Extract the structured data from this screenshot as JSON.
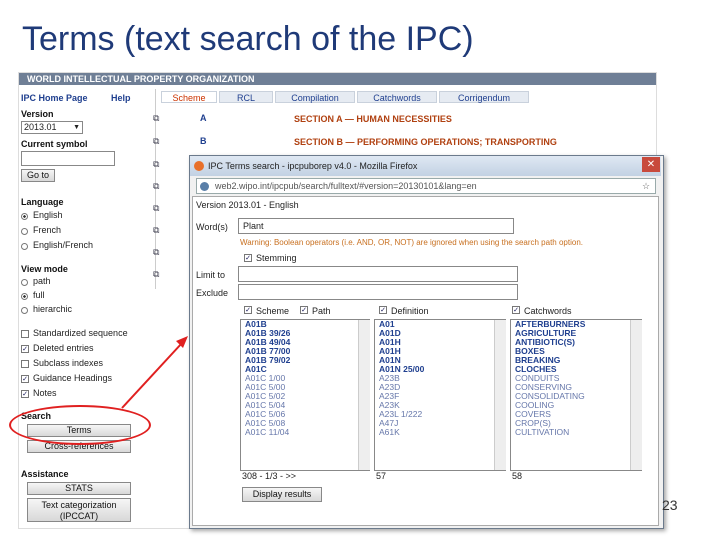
{
  "slide": {
    "title": "Terms (text search of the IPC)",
    "page_number": "23"
  },
  "wipo": {
    "header": "WORLD INTELLECTUAL PROPERTY ORGANIZATION",
    "nav": {
      "home": "IPC Home Page",
      "help": "Help"
    },
    "version_label": "Version",
    "version_value": "2013.01",
    "current_symbol_label": "Current symbol",
    "goto_button": "Go to",
    "language_label": "Language",
    "languages": [
      "English",
      "French",
      "English/French"
    ],
    "view_mode_label": "View mode",
    "view_modes": [
      "path",
      "full",
      "hierarchic"
    ],
    "options": [
      "Standardized sequence",
      "Deleted entries",
      "Subclass indexes",
      "Guidance Headings",
      "Notes"
    ],
    "search_label": "Search",
    "terms_button": "Terms",
    "crossref_button": "Cross-references",
    "assistance_label": "Assistance",
    "stats_button": "STATS",
    "textcat_button": "Text categorization (IPCCAT)",
    "tabs": [
      "Scheme",
      "RCL",
      "Compilation",
      "Catchwords",
      "Corrigendum"
    ],
    "sections": [
      {
        "letter": "A",
        "title": "SECTION A — HUMAN NECESSITIES"
      },
      {
        "letter": "B",
        "title": "SECTION B — PERFORMING OPERATIONS; TRANSPORTING"
      }
    ]
  },
  "dialog": {
    "window_title": "IPC Terms search - ipcpuborep v4.0 - Mozilla Firefox",
    "url": "web2.wipo.int/ipcpub/search/fulltext/#version=20130101&lang=en",
    "version_line": "Version 2013.01 - English",
    "words_label": "Word(s)",
    "words_value": "Plant",
    "warning": "Warning: Boolean operators (i.e. AND, OR, NOT) are ignored when using the search path option.",
    "stemming_label": "Stemming",
    "limit_label": "Limit to",
    "exclude_label": "Exclude",
    "scheme_label": "Scheme",
    "path_label": "Path",
    "definition_label": "Definition",
    "catchwords_label": "Catchwords",
    "scheme_list": [
      "A01B",
      "A01B 39/26",
      "A01B 49/04",
      "A01B 77/00",
      "A01B 79/02",
      "A01C",
      "A01C 1/00",
      "A01C 5/00",
      "A01C 5/02",
      "A01C 5/04",
      "A01C 5/06",
      "A01C 5/08",
      "A01C 11/04"
    ],
    "scheme_footer": "308 - 1/3 - >>",
    "definition_list": [
      "A01",
      "A01D",
      "A01H",
      "A01H",
      "A01N",
      "A01N 25/00",
      "A23B",
      "A23D",
      "A23F",
      "A23K",
      "A23L 1/222",
      "A47J",
      "A61K"
    ],
    "definition_footer": "57",
    "catchwords_list": [
      "AFTERBURNERS",
      "AGRICULTURE",
      "ANTIBIOTIC(S)",
      "BOXES",
      "BREAKING",
      "CLOCHES",
      "CONDUITS",
      "CONSERVING",
      "CONSOLIDATING",
      "COOLING",
      "COVERS",
      "CROP(S)",
      "CULTIVATION"
    ],
    "catchwords_footer": "58",
    "display_button": "Display results"
  },
  "colors": {
    "title": "#1f3a78",
    "annotation": "#e02020",
    "section": "#b04010"
  }
}
